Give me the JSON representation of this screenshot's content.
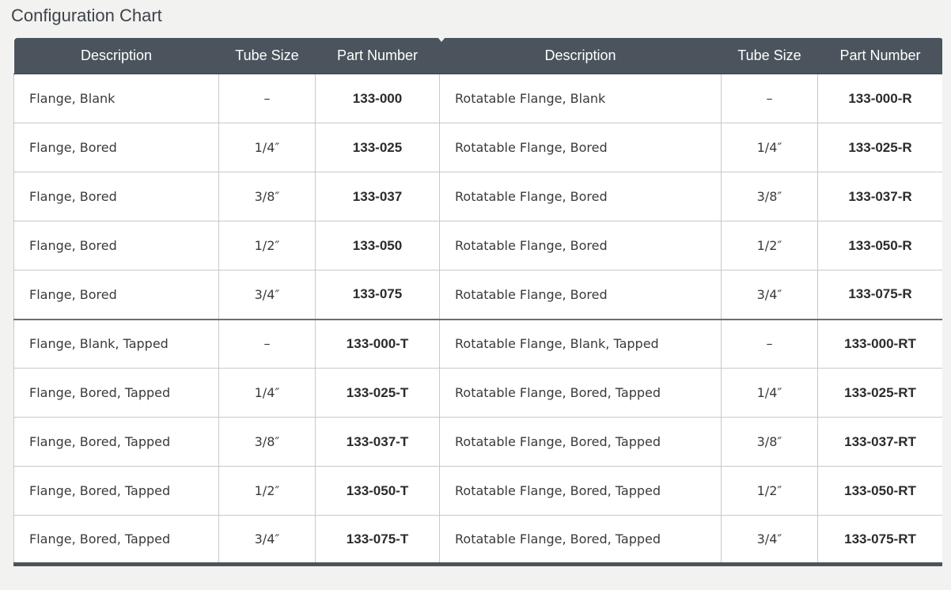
{
  "page": {
    "title": "Configuration Chart"
  },
  "colors": {
    "header_bg": "#4b545c",
    "header_text": "#ffffff",
    "page_bg": "#f2f2f0",
    "cell_border": "#c9c9c9"
  },
  "table": {
    "headers": [
      "Description",
      "Tube Size",
      "Part Number",
      "Description",
      "Tube Size",
      "Part Number"
    ],
    "rows": [
      [
        "Flange, Blank",
        "–",
        "133-000",
        "Rotatable Flange, Blank",
        "–",
        "133-000-R"
      ],
      [
        "Flange, Bored",
        "1/4″",
        "133-025",
        "Rotatable Flange, Bored",
        "1/4″",
        "133-025-R"
      ],
      [
        "Flange, Bored",
        "3/8″",
        "133-037",
        "Rotatable Flange, Bored",
        "3/8″",
        "133-037-R"
      ],
      [
        "Flange, Bored",
        "1/2″",
        "133-050",
        "Rotatable Flange, Bored",
        "1/2″",
        "133-050-R"
      ],
      [
        "Flange, Bored",
        "3/4″",
        "133-075",
        "Rotatable Flange, Bored",
        "3/4″",
        "133-075-R"
      ],
      [
        "Flange, Blank, Tapped",
        "–",
        "133-000-T",
        "Rotatable Flange, Blank, Tapped",
        "–",
        "133-000-RT"
      ],
      [
        "Flange, Bored, Tapped",
        "1/4″",
        "133-025-T",
        "Rotatable Flange, Bored, Tapped",
        "1/4″",
        "133-025-RT"
      ],
      [
        "Flange, Bored, Tapped",
        "3/8″",
        "133-037-T",
        "Rotatable Flange, Bored, Tapped",
        "3/8″",
        "133-037-RT"
      ],
      [
        "Flange, Bored, Tapped",
        "1/2″",
        "133-050-T",
        "Rotatable Flange, Bored, Tapped",
        "1/2″",
        "133-050-RT"
      ],
      [
        "Flange, Bored, Tapped",
        "3/4″",
        "133-075-T",
        "Rotatable Flange, Bored, Tapped",
        "3/4″",
        "133-075-RT"
      ]
    ]
  }
}
